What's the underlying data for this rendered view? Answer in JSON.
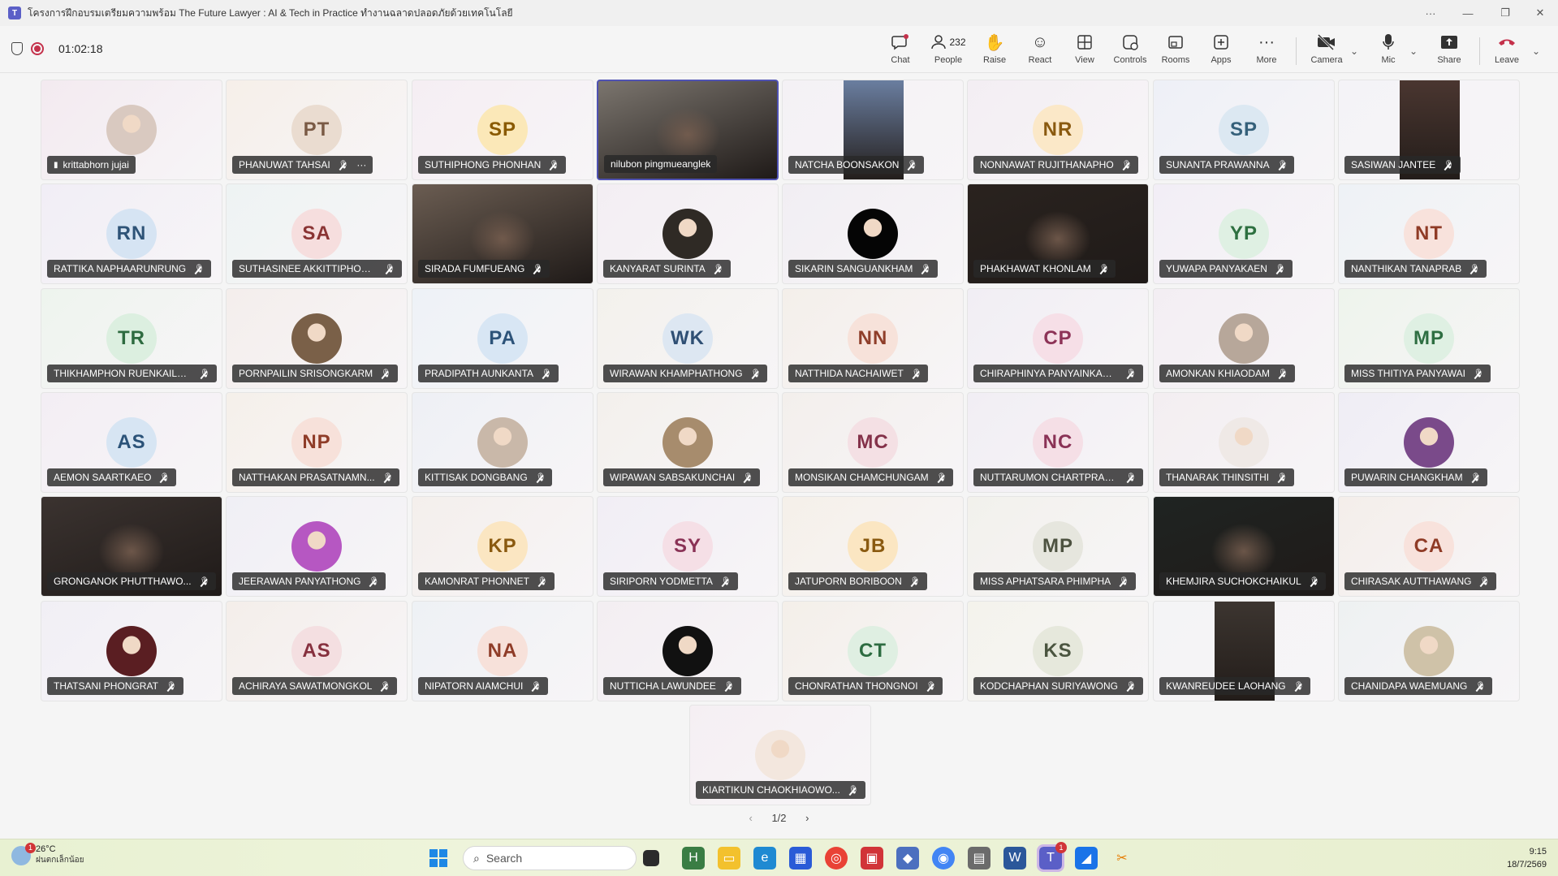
{
  "window": {
    "title": "โครงการฝึกอบรมเตรียมความพร้อม The Future Lawyer : AI & Tech in Practice ทำงานฉลาดปลอดภัยด้วยเทคโนโลยี",
    "controls": [
      "···",
      "—",
      "❐",
      "✕"
    ]
  },
  "meeting": {
    "timer": "01:02:18",
    "toolbar": [
      {
        "name": "chat",
        "label": "Chat",
        "icon": "chat-icon"
      },
      {
        "name": "people",
        "label": "People",
        "count": "232",
        "icon": "people-icon"
      },
      {
        "name": "raise",
        "label": "Raise",
        "icon": "hand-icon"
      },
      {
        "name": "react",
        "label": "React",
        "icon": "smile-icon"
      },
      {
        "name": "view",
        "label": "View",
        "icon": "grid-icon"
      },
      {
        "name": "controls",
        "label": "Controls",
        "icon": "controls-icon"
      },
      {
        "name": "rooms",
        "label": "Rooms",
        "icon": "rooms-icon"
      },
      {
        "name": "apps",
        "label": "Apps",
        "icon": "plus-icon"
      },
      {
        "name": "more",
        "label": "More",
        "icon": "more-icon"
      },
      {
        "name": "camera",
        "label": "Camera",
        "icon": "camera-off-icon"
      },
      {
        "name": "mic",
        "label": "Mic",
        "icon": "mic-icon"
      },
      {
        "name": "share",
        "label": "Share",
        "icon": "share-icon"
      },
      {
        "name": "leave",
        "label": "Leave",
        "icon": "phone-hangup-icon"
      }
    ]
  },
  "participants": [
    {
      "name": "krittabhorn jujai",
      "initials": "",
      "kind": "photo",
      "bg": "#f3eaf0",
      "avc": "#d9c9c0"
    },
    {
      "name": "PHANUWAT TAHSAI",
      "initials": "PT",
      "kind": "initials",
      "bg": "#f6efe9",
      "avc": "#eadcd0",
      "tc": "#7a5a45"
    },
    {
      "name": "SUTHIPHONG PHONHAN",
      "initials": "SP",
      "kind": "initials",
      "bg": "#f5eef3",
      "avc": "#fbe8b8",
      "tc": "#8a5a00"
    },
    {
      "name": "nilubon pingmueanglek",
      "initials": "",
      "kind": "video",
      "bg": "#7b756e",
      "avc": "",
      "active": true
    },
    {
      "name": "NATCHA BOONSAKON",
      "initials": "",
      "kind": "video-narrow",
      "bg": "#f4f1f5",
      "avc": "#6a7ea0"
    },
    {
      "name": "NONNAWAT RUJITHANAPHO",
      "initials": "NR",
      "kind": "initials",
      "bg": "#f3eef3",
      "avc": "#fbe8c8",
      "tc": "#8a5a10"
    },
    {
      "name": "SUNANTA PRAWANNA",
      "initials": "SP",
      "kind": "initials",
      "bg": "#eef0f7",
      "avc": "#dce8f2",
      "tc": "#35607a"
    },
    {
      "name": "SASIWAN JANTEE",
      "initials": "",
      "kind": "video-narrow",
      "bg": "#f4f3f7",
      "avc": "#4a3630"
    },
    {
      "name": "RATTIKA NAPHAARUNRUNG",
      "initials": "RN",
      "kind": "initials",
      "bg": "#f1eef6",
      "avc": "#d6e4f3",
      "tc": "#2e5377"
    },
    {
      "name": "SUTHASINEE AKKITTIPHOO...",
      "initials": "SA",
      "kind": "initials",
      "bg": "#eef3f3",
      "avc": "#f6dede",
      "tc": "#8a3434"
    },
    {
      "name": "SIRADA FUMFUEANG",
      "initials": "",
      "kind": "video",
      "bg": "#6b5d52",
      "avc": ""
    },
    {
      "name": "KANYARAT SURINTA",
      "initials": "",
      "kind": "photo",
      "bg": "#f3eef3",
      "avc": "#2f2a25"
    },
    {
      "name": "SIKARIN SANGUANKHAM",
      "initials": "",
      "kind": "photo",
      "bg": "#f1eef3",
      "avc": "#050505"
    },
    {
      "name": "PHAKHAWAT KHONLAM",
      "initials": "",
      "kind": "video",
      "bg": "#2a231f",
      "avc": ""
    },
    {
      "name": "YUWAPA PANYAKAEN",
      "initials": "YP",
      "kind": "initials",
      "bg": "#f2eef6",
      "avc": "#dff0e3",
      "tc": "#2d7040"
    },
    {
      "name": "NANTHIKAN TANAPRAB",
      "initials": "NT",
      "kind": "initials",
      "bg": "#eef2f6",
      "avc": "#f8e2dc",
      "tc": "#8f3b26"
    },
    {
      "name": "THIKHAMPHON RUENKAILO...",
      "initials": "TR",
      "kind": "initials",
      "bg": "#eef4ee",
      "avc": "#dcefe0",
      "tc": "#2e6b40"
    },
    {
      "name": "PORNPAILIN SRISONGKARM",
      "initials": "",
      "kind": "photo",
      "bg": "#f4eeec",
      "avc": "#7a6048"
    },
    {
      "name": "PRADIPATH AUNKANTA",
      "initials": "PA",
      "kind": "initials",
      "bg": "#eef2f7",
      "avc": "#d8e6f4",
      "tc": "#2d5379"
    },
    {
      "name": "WIRAWAN KHAMPHATHONG",
      "initials": "WK",
      "kind": "initials",
      "bg": "#f3f1ec",
      "avc": "#dde7f2",
      "tc": "#2f4f74"
    },
    {
      "name": "NATTHIDA NACHAIWET",
      "initials": "NN",
      "kind": "initials",
      "bg": "#f4efea",
      "avc": "#f7e2da",
      "tc": "#8f3e2a"
    },
    {
      "name": "CHIRAPHINYA PANYAINKAEW",
      "initials": "CP",
      "kind": "initials",
      "bg": "#f1eef4",
      "avc": "#f6dfe7",
      "tc": "#8d3357"
    },
    {
      "name": "AMONKAN KHIAODAM",
      "initials": "",
      "kind": "photo",
      "bg": "#f3eef3",
      "avc": "#b7a79a"
    },
    {
      "name": "MISS THITIYA PANYAWAI",
      "initials": "MP",
      "kind": "initials",
      "bg": "#eef4ec",
      "avc": "#dff0e3",
      "tc": "#2e6e42"
    },
    {
      "name": "AEMON SAARTKAEO",
      "initials": "AS",
      "kind": "initials",
      "bg": "#f3eef4",
      "avc": "#d7e5f3",
      "tc": "#2b5278"
    },
    {
      "name": "NATTHAKAN PRASATNAMN...",
      "initials": "NP",
      "kind": "initials",
      "bg": "#f5f0ea",
      "avc": "#f7e1da",
      "tc": "#8f3c28"
    },
    {
      "name": "KITTISAK DONGBANG",
      "initials": "",
      "kind": "photo",
      "bg": "#eef0f5",
      "avc": "#c9b8a9"
    },
    {
      "name": "WIPAWAN SABSAKUNCHAI",
      "initials": "",
      "kind": "photo",
      "bg": "#f3f0ec",
      "avc": "#a78c6d"
    },
    {
      "name": "MONSIKAN CHAMCHUNGAM",
      "initials": "MC",
      "kind": "initials",
      "bg": "#f3efec",
      "avc": "#f4e0e4",
      "tc": "#84324a"
    },
    {
      "name": "NUTTARUMON CHARTPRASE...",
      "initials": "NC",
      "kind": "initials",
      "bg": "#f1eef4",
      "avc": "#f5dfe6",
      "tc": "#8a3256"
    },
    {
      "name": "THANARAK THINSITHI",
      "initials": "",
      "kind": "photo",
      "bg": "#f3eef1",
      "avc": "#efe9e6"
    },
    {
      "name": "PUWARIN CHANGKHAM",
      "initials": "",
      "kind": "photo",
      "bg": "#efedf5",
      "avc": "#7a4a8a"
    },
    {
      "name": "GRONGANOK PHUTTHAWO...",
      "initials": "",
      "kind": "video",
      "bg": "#3b3330",
      "avc": ""
    },
    {
      "name": "JEERAWAN PANYATHONG",
      "initials": "",
      "kind": "photo",
      "bg": "#f0eff5",
      "avc": "#b657c2"
    },
    {
      "name": "KAMONRAT PHONNET",
      "initials": "KP",
      "kind": "initials",
      "bg": "#f4efec",
      "avc": "#fbe6c2",
      "tc": "#8a5a10"
    },
    {
      "name": "SIRIPORN YODMETTA",
      "initials": "SY",
      "kind": "initials",
      "bg": "#f1eef5",
      "avc": "#f5dfe6",
      "tc": "#8a3256"
    },
    {
      "name": "JATUPORN BORIBOON",
      "initials": "JB",
      "kind": "initials",
      "bg": "#f5f0e9",
      "avc": "#fbe6c2",
      "tc": "#8a5a10"
    },
    {
      "name": "MISS APHATSARA PHIMPHA",
      "initials": "MP",
      "kind": "initials",
      "bg": "#f2f1ec",
      "avc": "#e6e6de",
      "tc": "#4d5240"
    },
    {
      "name": "KHEMJIRA SUCHOKCHAIKUL",
      "initials": "",
      "kind": "video",
      "bg": "#1f2422",
      "avc": ""
    },
    {
      "name": "CHIRASAK AUTTHAWANG",
      "initials": "CA",
      "kind": "initials",
      "bg": "#f4eeea",
      "avc": "#f8e2dc",
      "tc": "#8f3b26"
    },
    {
      "name": "THATSANI PHONGRAT",
      "initials": "",
      "kind": "photo",
      "bg": "#f1eff5",
      "avc": "#5a1e22"
    },
    {
      "name": "ACHIRAYA SAWATMONGKOL",
      "initials": "AS",
      "kind": "initials",
      "bg": "#f4eeea",
      "avc": "#f4dfe1",
      "tc": "#86303e"
    },
    {
      "name": "NIPATORN AIAMCHUI",
      "initials": "NA",
      "kind": "initials",
      "bg": "#eef1f5",
      "avc": "#f7e1da",
      "tc": "#8f3c28"
    },
    {
      "name": "NUTTICHA LAWUNDEE",
      "initials": "",
      "kind": "photo",
      "bg": "#f3eef2",
      "avc": "#111"
    },
    {
      "name": "CHONRATHAN THONGNOI",
      "initials": "CT",
      "kind": "initials",
      "bg": "#f4efe9",
      "avc": "#dfefe2",
      "tc": "#2d6c41"
    },
    {
      "name": "KODCHAPHAN SURIYAWONG",
      "initials": "KS",
      "kind": "initials",
      "bg": "#f4f3ec",
      "avc": "#e6e8dc",
      "tc": "#4b5540"
    },
    {
      "name": "KWANREUDEE LAOHANG",
      "initials": "",
      "kind": "video-narrow",
      "bg": "#f4f4f6",
      "avc": "#3c3530"
    },
    {
      "name": "CHANIDAPA WAEMUANG",
      "initials": "",
      "kind": "photo",
      "bg": "#eef1f2",
      "avc": "#cfc2a8"
    },
    {
      "name": "KIARTIKUN CHAOKHIAOWO...",
      "initials": "",
      "kind": "photo",
      "bg": "#f5eff3",
      "avc": "#f3e7de"
    }
  ],
  "pager": {
    "label": "1/2",
    "prev": "‹",
    "next": "›"
  },
  "taskbar": {
    "weather_temp": "26°C",
    "weather_desc": "ฝนตกเล็กน้อย",
    "weather_badge": "1",
    "search_placeholder": "Search",
    "time": "9:15",
    "date": "18/7/2569",
    "teams_badge": "1"
  }
}
